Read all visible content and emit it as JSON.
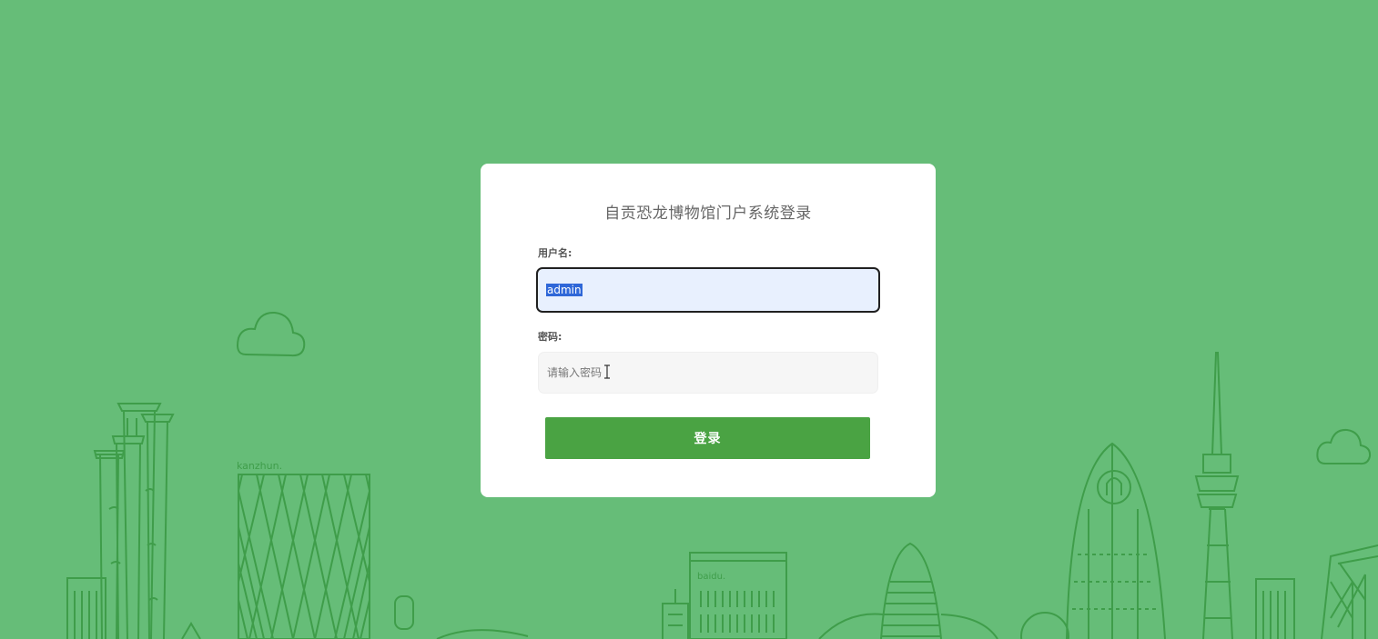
{
  "login": {
    "title": "自贡恐龙博物馆门户系统登录",
    "username_label": "用户名:",
    "username_value": "admin",
    "password_label": "密码:",
    "password_placeholder": "请输入密码",
    "submit_label": "登录"
  },
  "background": {
    "sign_left": "kanzhun.",
    "sign_center": "baidu."
  },
  "colors": {
    "page_bg": "#66bd78",
    "line_art": "#3f9d4a",
    "button": "#4aa343",
    "card": "#ffffff",
    "selection": "#2f67d8"
  }
}
